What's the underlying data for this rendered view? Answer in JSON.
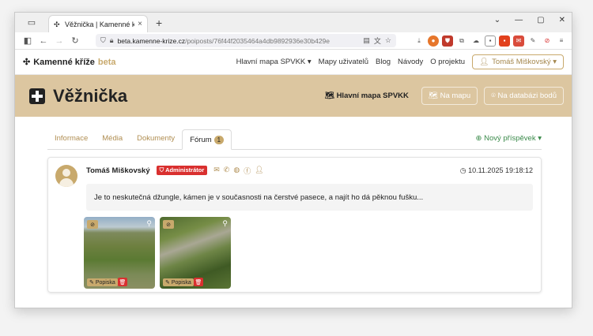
{
  "browser": {
    "tab_title": "Věžnička | Kamenné kříže",
    "tab_close": "×",
    "new_tab": "+",
    "url_domain": "beta.kamenne-krize.cz",
    "url_path": "/poiposts/76f44f2035464a4db9892936e30b429e"
  },
  "nav": {
    "brand": "Kamenné kříže",
    "brand_beta": "beta",
    "links": [
      "Hlavní mapa SPVKK ▾",
      "Mapy uživatelů",
      "Blog",
      "Návody",
      "O projektu"
    ],
    "user": "Tomáš Miškovský ▾"
  },
  "header": {
    "title": "Věžnička",
    "map_link": "Hlavní mapa SPVKK",
    "btn_map": "Na mapu",
    "btn_db": "Na databázi bodů"
  },
  "tabs": {
    "items": [
      "Informace",
      "Média",
      "Dokumenty"
    ],
    "active": "Fórum",
    "active_badge": "1",
    "new_post": "Nový příspěvek ▾"
  },
  "post": {
    "author": "Tomáš Miškovský",
    "role": "Administrátor",
    "date": "10.11.2025 19:18:12",
    "body": "Je to neskutečná džungle, kámen je v současnosti na čerstvé pasece, a najít ho dá pěknou fušku...",
    "images": [
      {
        "caption": "Popiska"
      },
      {
        "caption": "Popiska"
      }
    ]
  },
  "colors": {
    "accent": "#c8a96c",
    "band": "#dcc6a0",
    "danger": "#d9302f",
    "success": "#3a8a4a"
  }
}
